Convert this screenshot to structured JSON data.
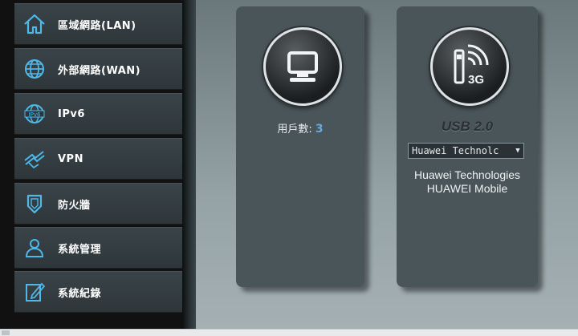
{
  "sidebar": {
    "items": [
      {
        "label": "區域網路(LAN)",
        "icon": "home-icon"
      },
      {
        "label": "外部網路(WAN)",
        "icon": "globe-icon"
      },
      {
        "label": "IPv6",
        "icon": "ipv6-globe-icon"
      },
      {
        "label": "VPN",
        "icon": "vpn-icon"
      },
      {
        "label": "防火牆",
        "icon": "shield-icon"
      },
      {
        "label": "系統管理",
        "icon": "user-admin-icon"
      },
      {
        "label": "系統紀錄",
        "icon": "log-edit-icon"
      }
    ]
  },
  "clients": {
    "label": "用戶數:",
    "count": "3",
    "icon": "monitor-icon"
  },
  "usb": {
    "title": "USB 2.0",
    "icon": "usb-3g-modem-icon",
    "icon_text": "3G",
    "selected": "Huawei Technolc",
    "desc_line1": "Huawei Technologies",
    "desc_line2": "HUAWEI Mobile"
  },
  "colors": {
    "accent": "#66aadd",
    "icon_blue": "#4fb8e8",
    "panel": "#4a5559"
  }
}
